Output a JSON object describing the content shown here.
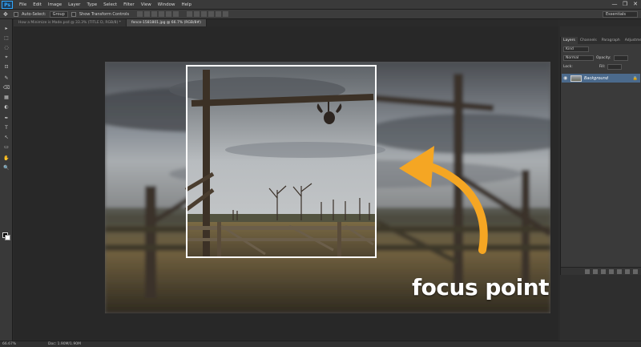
{
  "app": {
    "logo": "Ps"
  },
  "menu": [
    "File",
    "Edit",
    "Image",
    "Layer",
    "Type",
    "Select",
    "Filter",
    "View",
    "Window",
    "Help"
  ],
  "window_controls": {
    "minimize": "—",
    "restore": "❐",
    "close": "✕"
  },
  "options_bar": {
    "auto_select_label": "Auto-Select:",
    "auto_select_value": "Group",
    "show_transform_label": "Show Transform Controls",
    "workspace": "Essentials"
  },
  "tabs": [
    {
      "label": "How a Minimize is Made.psd @ 33.3% (TITLE D, RGB/8) *"
    },
    {
      "label": "fence-1581801.jpg @ 66.7% (RGB/8#)"
    }
  ],
  "tools": [
    "▸",
    "⬚",
    "◌",
    "⌖",
    "⊡",
    "✎",
    "⌫",
    "▦",
    "◐",
    "✒",
    "T",
    "↖",
    "▭",
    "✋",
    "🔍"
  ],
  "panel": {
    "tabs": [
      "Layers",
      "Channels",
      "Paragraph",
      "Adjustme"
    ],
    "kind_field": "Kind",
    "blend_mode": "Normal",
    "opacity_label": "Opacity:",
    "lock_label": "Lock:",
    "fill_label": "Fill:",
    "layer": {
      "name": "Background",
      "lock": "🔒"
    }
  },
  "canvas": {
    "annotation_text": "focus point",
    "arrow_color": "#f5a623"
  },
  "status": {
    "zoom": "66.67%",
    "doc": "Doc: 1.90M/1.90M"
  }
}
